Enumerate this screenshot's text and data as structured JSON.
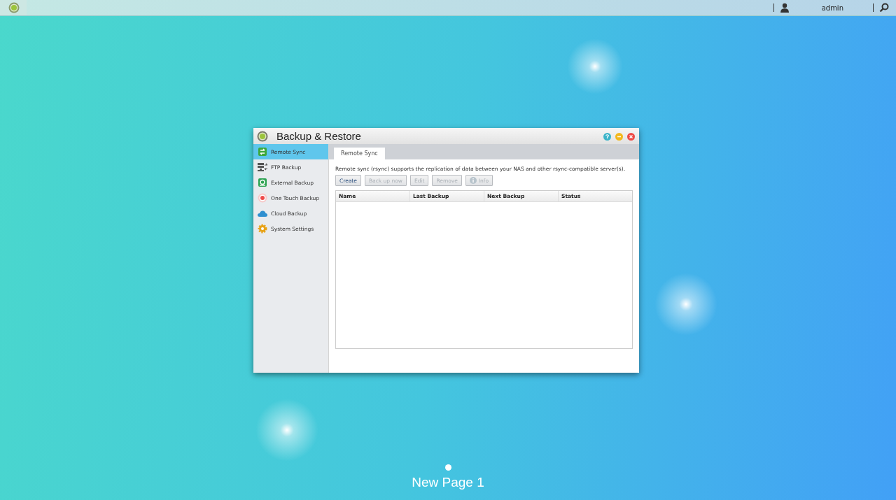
{
  "top_bar": {
    "user": "admin"
  },
  "window": {
    "title": "Backup & Restore"
  },
  "sidebar": {
    "items": [
      {
        "label": "Remote Sync",
        "kind": "sync",
        "selected": true
      },
      {
        "label": "FTP Backup",
        "kind": "ftp",
        "selected": false
      },
      {
        "label": "External Backup",
        "kind": "external",
        "selected": false
      },
      {
        "label": "One Touch Backup",
        "kind": "onetouch",
        "selected": false
      },
      {
        "label": "Cloud Backup",
        "kind": "cloud",
        "selected": false
      },
      {
        "label": "System Settings",
        "kind": "settings",
        "selected": false
      }
    ]
  },
  "tabs": [
    {
      "label": "Remote Sync",
      "selected": true
    }
  ],
  "description": "Remote sync (rsync) supports the replication of data between your NAS and other rsync-compatible server(s).",
  "toolbar": [
    {
      "label": "Create",
      "disabled": false
    },
    {
      "label": "Back up now",
      "disabled": true
    },
    {
      "label": "Edit",
      "disabled": true
    },
    {
      "label": "Remove",
      "disabled": true
    },
    {
      "label": "Info",
      "disabled": true,
      "kind": "info"
    }
  ],
  "table": {
    "columns": [
      "Name",
      "Last Backup",
      "Next Backup",
      "Status"
    ]
  },
  "desktop": {
    "page_label": "New Page 1"
  }
}
